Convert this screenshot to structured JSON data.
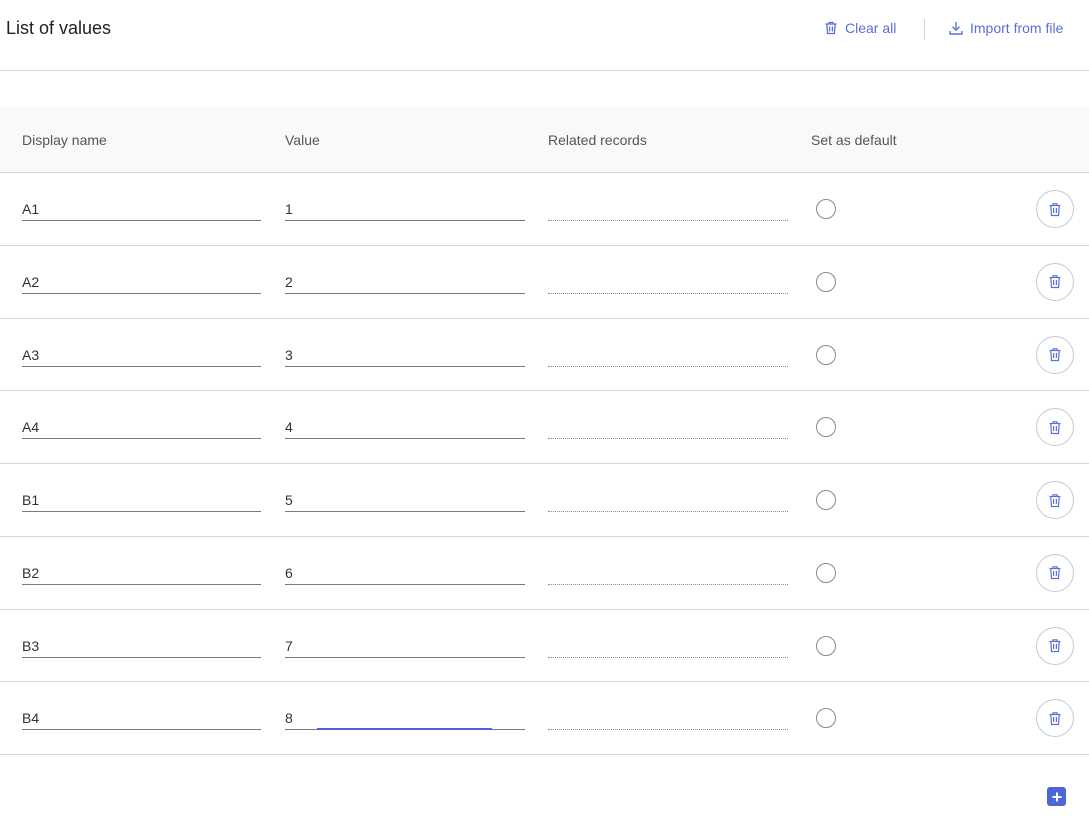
{
  "header": {
    "title": "List of values",
    "clear_all_label": "Clear all",
    "import_label": "Import from file"
  },
  "table": {
    "columns": [
      "Display name",
      "Value",
      "Related records",
      "Set as default"
    ],
    "rows": [
      {
        "name": "A1",
        "value": "1",
        "related": "",
        "default": false
      },
      {
        "name": "A2",
        "value": "2",
        "related": "",
        "default": false
      },
      {
        "name": "A3",
        "value": "3",
        "related": "",
        "default": false
      },
      {
        "name": "A4",
        "value": "4",
        "related": "",
        "default": false
      },
      {
        "name": "B1",
        "value": "5",
        "related": "",
        "default": false
      },
      {
        "name": "B2",
        "value": "6",
        "related": "",
        "default": false
      },
      {
        "name": "B3",
        "value": "7",
        "related": "",
        "default": false
      },
      {
        "name": "B4",
        "value": "8",
        "related": "",
        "default": false
      }
    ]
  },
  "icons": {
    "clear_all": "trash-icon",
    "import": "download-icon",
    "row_delete": "trash-icon",
    "add": "plus-icon"
  },
  "colors": {
    "accent": "#5b6fd6",
    "add_button": "#4b66d9"
  }
}
